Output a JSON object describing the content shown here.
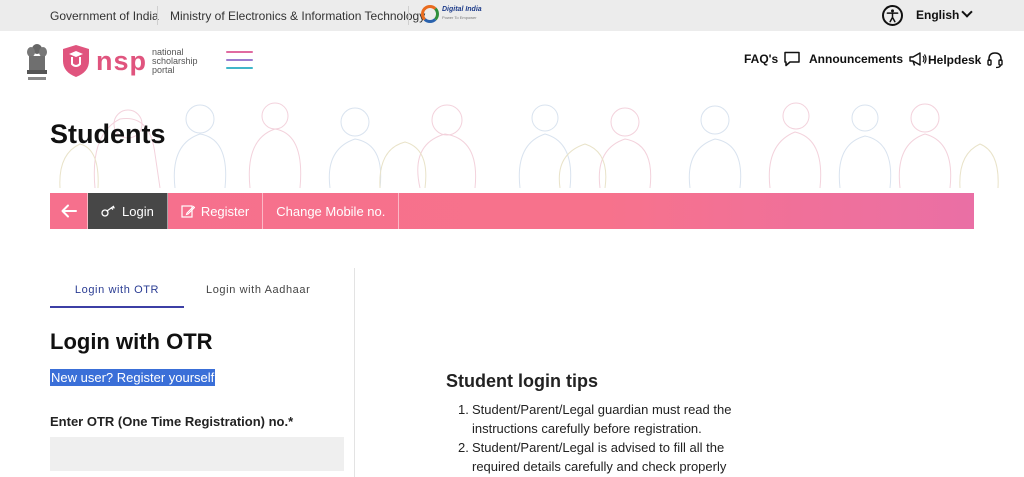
{
  "govbar": {
    "gov": "Government of India",
    "ministry": "Ministry of Electronics & Information Technology",
    "digital_india": "Digital India",
    "digital_tag": "Power To Empower",
    "language": "English"
  },
  "header": {
    "logo_word": "nsp",
    "logo_tag": [
      "national",
      "scholarship",
      "portal"
    ],
    "faqs": "FAQ's",
    "announcements": "Announcements",
    "helpdesk": "Helpdesk"
  },
  "page": {
    "title": "Students"
  },
  "nav": {
    "login": "Login",
    "register": "Register",
    "change_mobile": "Change Mobile no."
  },
  "login": {
    "tabs": [
      "Login with OTR",
      "Login with Aadhaar"
    ],
    "heading": "Login with OTR",
    "new_user": "New user? Register yourself",
    "otr_label": "Enter OTR (One Time Registration) no.*",
    "otr_value": ""
  },
  "tips": {
    "title": "Student login tips",
    "items": [
      {
        "n": "1.",
        "text": "Student/Parent/Legal guardian must read the instructions carefully before registration."
      },
      {
        "n": "2.",
        "text": "Student/Parent/Legal is advised to fill all the required details carefully and check properly"
      }
    ]
  },
  "colors": {
    "accent_pink": "#f6708d",
    "nav_active": "#474747",
    "tab_blue": "#2a3c93",
    "highlight": "#3a6fd8"
  }
}
